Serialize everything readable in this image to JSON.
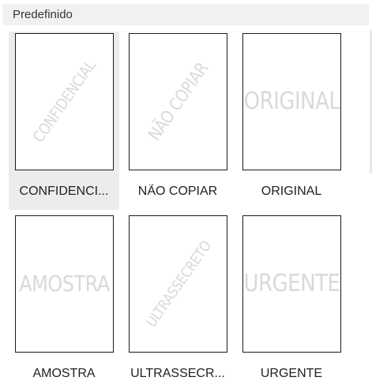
{
  "section": {
    "title": "Predefinido"
  },
  "tiles": [
    {
      "watermark": "CONFIDENCIAL",
      "label": "CONFIDENCI...",
      "orientation": "diagonal",
      "selected": true
    },
    {
      "watermark": "NÃO COPIAR",
      "label": "NÃO COPIAR",
      "orientation": "diagonal",
      "selected": false
    },
    {
      "watermark": "ORIGINAL",
      "label": "ORIGINAL",
      "orientation": "horizontal",
      "selected": false
    },
    {
      "watermark": "AMOSTRA",
      "label": "AMOSTRA",
      "orientation": "horizontal",
      "selected": false
    },
    {
      "watermark": "ULTRASSECRETO",
      "label": "ULTRASSECR...",
      "orientation": "diagonal",
      "selected": false
    },
    {
      "watermark": "URGENTE",
      "label": "URGENTE",
      "orientation": "horizontal",
      "selected": false
    }
  ],
  "colors": {
    "watermark": "#d9d9d9",
    "selected_background": "#ececec",
    "header_background": "#f1f1f1"
  }
}
